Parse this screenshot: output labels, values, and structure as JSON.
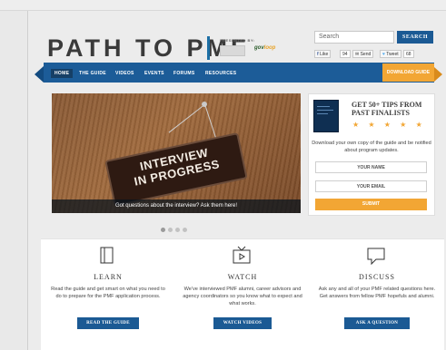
{
  "header": {
    "logo_text": "PATH TO PMF",
    "presented_by": "PRESENTED BY:",
    "sponsor2_text": "gov",
    "sponsor2_accent": "loop",
    "search_placeholder": "Search",
    "search_button": "SEARCH",
    "social": {
      "like_label": "Like",
      "like_count": "94",
      "send_label": "Send",
      "tweet_label": "Tweet",
      "tweet_count": "68"
    }
  },
  "nav": {
    "items": [
      {
        "label": "HOME",
        "active": true
      },
      {
        "label": "THE GUIDE"
      },
      {
        "label": "VIDEOS"
      },
      {
        "label": "EVENTS"
      },
      {
        "label": "FORUMS"
      },
      {
        "label": "RESOURCES"
      }
    ],
    "download_button": "DOWNLOAD GUIDE"
  },
  "hero": {
    "sign_line1": "INTERVIEW",
    "sign_line2": "IN PROGRESS",
    "caption": "Got questions about the interview? Ask them here!",
    "slide_count": 4,
    "active_slide": 1
  },
  "promo": {
    "title": "GET 50+ TIPS FROM PAST FINALISTS",
    "stars": "★ ★ ★ ★ ★",
    "text": "Download your own copy of the guide and be notified about program updates.",
    "name_placeholder": "YOUR NAME",
    "email_placeholder": "YOUR EMAIL",
    "submit_label": "SUBMIT"
  },
  "features": [
    {
      "icon": "book-icon",
      "title": "LEARN",
      "text": "Read the guide and get smart on what you need to do to prepare for the PMF application process.",
      "button": "READ THE GUIDE"
    },
    {
      "icon": "tv-play-icon",
      "title": "WATCH",
      "text": "We've interviewed PMF alumni, career advisors and agency coordinators so you know what to expect and what works.",
      "button": "WATCH VIDEOS"
    },
    {
      "icon": "speech-bubble-icon",
      "title": "DISCUSS",
      "text": "Ask any and all of your PMF related questions here. Get answers from fellow PMF hopefuls and alumni.",
      "button": "ASK A QUESTION"
    }
  ],
  "colors": {
    "brand_blue": "#1c5c98",
    "accent_orange": "#f2a634"
  }
}
